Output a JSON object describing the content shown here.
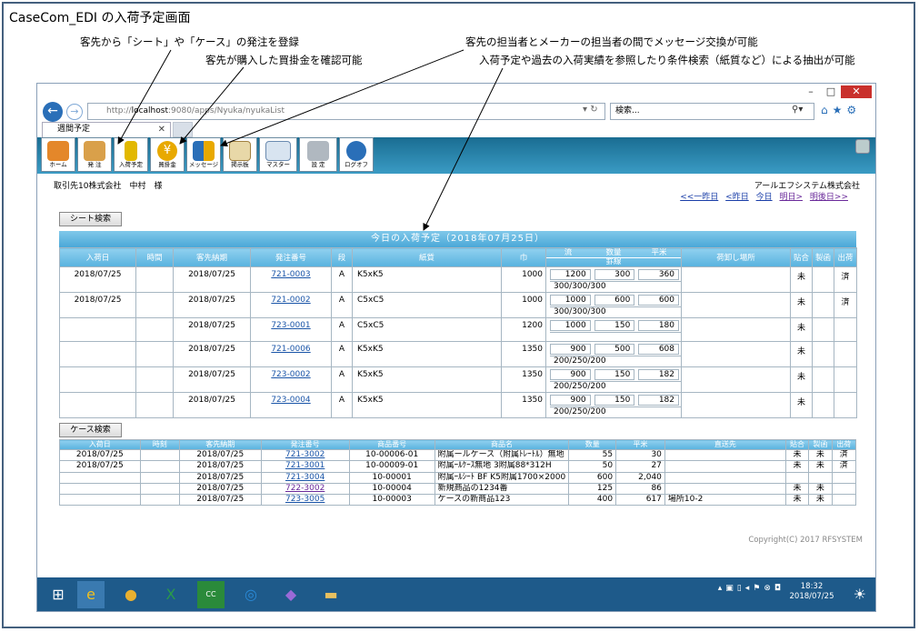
{
  "doc_title": "CaseCom_EDI の入荷予定画面",
  "annotations": [
    "客先から「シート」や「ケース」の発注を登録",
    "客先が購入した買掛金を確認可能",
    "客先の担当者とメーカーの担当者の間でメッセージ交換が可能",
    "入荷予定や過去の入荷実績を参照したり条件検索（紙質など）による抽出が可能"
  ],
  "browser": {
    "url_prefix": "http://",
    "url_host": "localhost",
    "url_path": ":9080/apps/Nyuka/nyukaList",
    "search_placeholder": "検索...",
    "tab_title": "週間予定"
  },
  "toolbar": [
    "ホーム",
    "発 注",
    "入荷予定",
    "買掛金",
    "メッセージ",
    "掲示板",
    "マスター",
    "設 定",
    "ログオフ"
  ],
  "user": "取引先10株式会社　中村　様",
  "company": "アールエフシステム株式会社",
  "date_nav": [
    "<<一昨日",
    "<昨日",
    "今日",
    "明日>",
    "明後日>>"
  ],
  "sheet_search": "シート検索",
  "case_search": "ケース検索",
  "banner": "今日の入荷予定（2018年07月25日）",
  "sheet_headers": {
    "arrival": "入荷日",
    "time": "時間",
    "due": "客先納期",
    "order": "発注番号",
    "step": "段",
    "paper": "紙質",
    "width": "巾",
    "flow": "流",
    "qty": "数量",
    "area": "平米",
    "lines": "罫線",
    "place": "荷卸し場所",
    "match": "貼合",
    "cut": "製函",
    "ship": "出荷"
  },
  "sheet_rows": [
    {
      "arrival": "2018/07/25",
      "due": "2018/07/25",
      "order": "721-0003",
      "step": "A",
      "paper": "K5xK5",
      "width": "1000",
      "flow": "1200",
      "qty": "300",
      "area": "360",
      "lines": "300/300/300",
      "match": "未",
      "ship": "済"
    },
    {
      "arrival": "2018/07/25",
      "due": "2018/07/25",
      "order": "721-0002",
      "step": "A",
      "paper": "C5xC5",
      "width": "1000",
      "flow": "1000",
      "qty": "600",
      "area": "600",
      "lines": "300/300/300",
      "match": "未",
      "ship": "済"
    },
    {
      "arrival": "",
      "due": "2018/07/25",
      "order": "723-0001",
      "step": "A",
      "paper": "C5xC5",
      "width": "1200",
      "flow": "1000",
      "qty": "150",
      "area": "180",
      "lines": "",
      "match": "未",
      "ship": ""
    },
    {
      "arrival": "",
      "due": "2018/07/25",
      "order": "721-0006",
      "step": "A",
      "paper": "K5xK5",
      "width": "1350",
      "flow": "900",
      "qty": "500",
      "area": "608",
      "lines": "200/250/200",
      "match": "未",
      "ship": ""
    },
    {
      "arrival": "",
      "due": "2018/07/25",
      "order": "723-0002",
      "step": "A",
      "paper": "K5xK5",
      "width": "1350",
      "flow": "900",
      "qty": "150",
      "area": "182",
      "lines": "200/250/200",
      "match": "未",
      "ship": ""
    },
    {
      "arrival": "",
      "due": "2018/07/25",
      "order": "723-0004",
      "step": "A",
      "paper": "K5xK5",
      "width": "1350",
      "flow": "900",
      "qty": "150",
      "area": "182",
      "lines": "200/250/200",
      "match": "未",
      "ship": ""
    }
  ],
  "case_headers": {
    "arrival": "入荷日",
    "time": "時刻",
    "due": "客先納期",
    "order": "発注番号",
    "code": "商品番号",
    "name": "商品名",
    "qty": "数量",
    "area": "平米",
    "dest": "直送先",
    "match": "貼合",
    "cut": "製函",
    "ship": "出荷"
  },
  "case_rows": [
    {
      "arrival": "2018/07/25",
      "due": "2018/07/25",
      "order": "721-3002",
      "code": "10-00006-01",
      "name": "附属ールケース（附属ﾄﾚｰﾄﾙ）無地",
      "qty": "55",
      "area": "30",
      "dest": "",
      "match": "未",
      "cut": "未",
      "ship": "済",
      "visited": false
    },
    {
      "arrival": "2018/07/25",
      "due": "2018/07/25",
      "order": "721-3001",
      "code": "10-00009-01",
      "name": "附属ｰﾙｹｰｽ無地 3附属88*312H",
      "qty": "50",
      "area": "27",
      "dest": "",
      "match": "未",
      "cut": "未",
      "ship": "済",
      "visited": false
    },
    {
      "arrival": "",
      "due": "2018/07/25",
      "order": "721-3004",
      "code": "10-00001",
      "name": "附属ｰﾙｼｰﾄ BF K5附属1700×2000",
      "qty": "600",
      "area": "2,040",
      "dest": "",
      "match": "",
      "cut": "",
      "ship": "",
      "visited": false
    },
    {
      "arrival": "",
      "due": "2018/07/25",
      "order": "722-3002",
      "code": "10-00004",
      "name": "新規商品の1234番",
      "qty": "125",
      "area": "86",
      "dest": "",
      "match": "未",
      "cut": "未",
      "ship": "",
      "visited": true
    },
    {
      "arrival": "",
      "due": "2018/07/25",
      "order": "723-3005",
      "code": "10-00003",
      "name": "ケースの新商品123",
      "qty": "400",
      "area": "617",
      "dest": "場所10-2",
      "match": "未",
      "cut": "未",
      "ship": "",
      "visited": false
    }
  ],
  "copyright": "Copyright(C) 2017 RFSYSTEM",
  "clock_time": "18:32",
  "clock_date": "2018/07/25"
}
